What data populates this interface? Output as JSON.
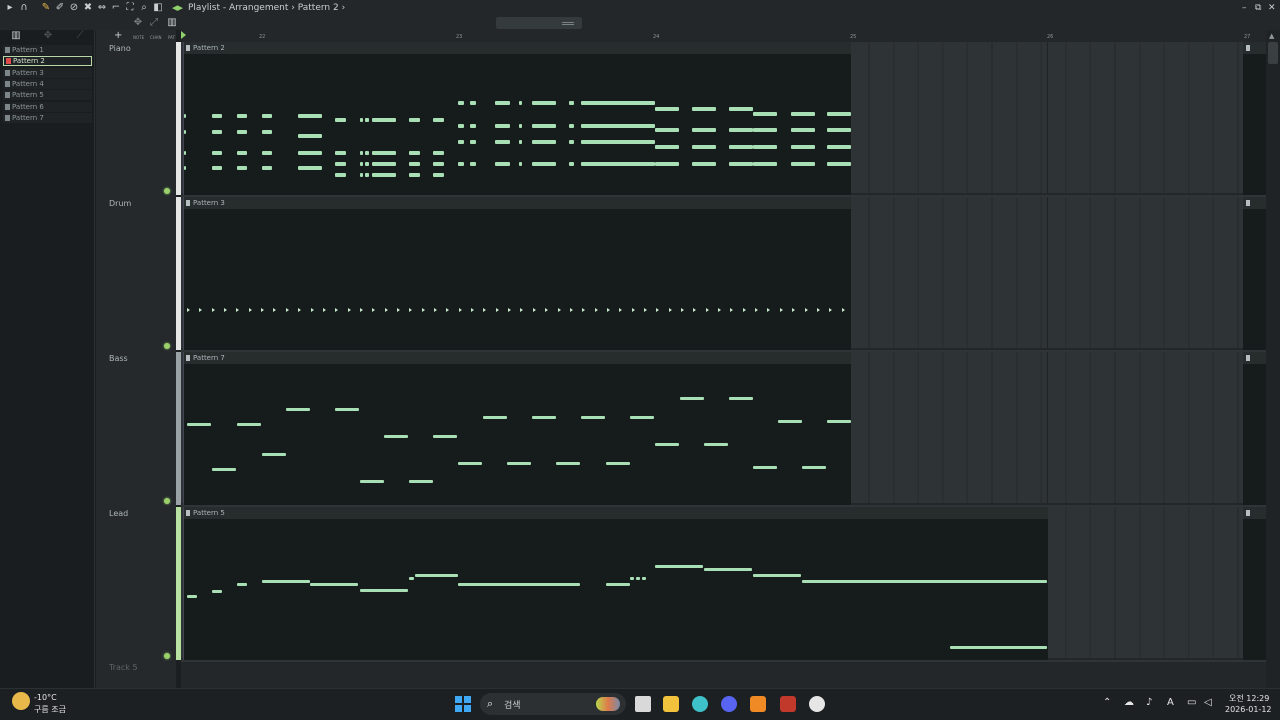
{
  "window": {
    "breadcrumb": "Playlist - Arrangement",
    "separator": "›",
    "current_pattern": "Pattern 2",
    "trailing": "›"
  },
  "toolbar": {
    "add_label": "+",
    "note_label": "NOTE",
    "chan_label": "CHAN",
    "pat_label": "PAT"
  },
  "patterns": [
    {
      "label": "Pattern 1",
      "selected": false
    },
    {
      "label": "Pattern 2",
      "selected": true
    },
    {
      "label": "Pattern 3",
      "selected": false
    },
    {
      "label": "Pattern 4",
      "selected": false
    },
    {
      "label": "Pattern 5",
      "selected": false
    },
    {
      "label": "Pattern 6",
      "selected": false
    },
    {
      "label": "Pattern 7",
      "selected": false
    }
  ],
  "ruler": {
    "bars": [
      "22",
      "23",
      "24",
      "25",
      "26",
      "27"
    ]
  },
  "tracks": [
    {
      "name": "Piano",
      "clip": "Pattern 2"
    },
    {
      "name": "Drum",
      "clip": "Pattern 3"
    },
    {
      "name": "Bass",
      "clip": "Pattern 7"
    },
    {
      "name": "Lead",
      "clip": "Pattern 5"
    },
    {
      "name": "Track 5",
      "clip": ""
    }
  ],
  "taskbar": {
    "temperature": "-10°C",
    "weather": "구름 조금",
    "search_placeholder": "검색",
    "time": "오전 12:29",
    "date": "2026-01-12",
    "ime": "A"
  },
  "colors": {
    "note": "#a9dfb4",
    "accent": "#8fd16b",
    "clip_bg": "#161b1b"
  }
}
